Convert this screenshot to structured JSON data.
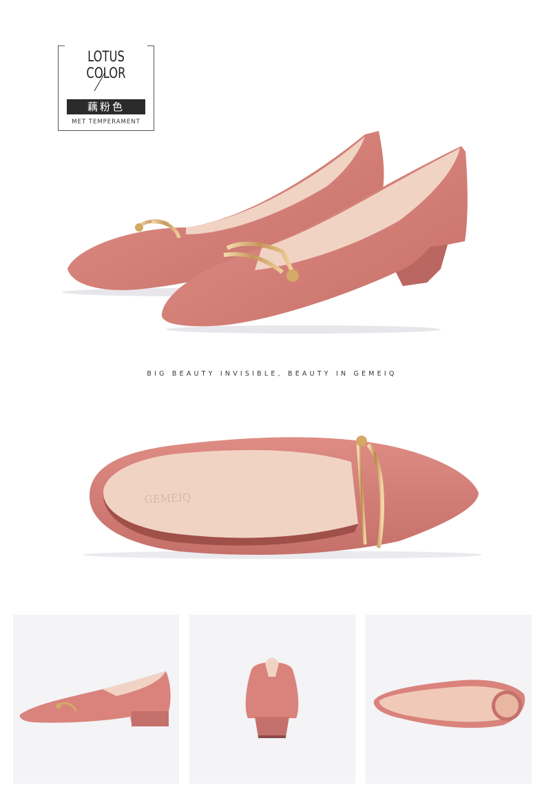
{
  "label": {
    "title_en": "LOTUS COLOR",
    "title_cn": "藕粉色",
    "subtitle": "MET TEMPERAMENT"
  },
  "tagline": "BIG BEAUTY INVISIBLE, BEAUTY IN GEMEIQ",
  "insole_brand": "GEMEIQ",
  "colors": {
    "suede": "#d9837c",
    "suede_dark": "#b96760",
    "lining": "#f1d3c4",
    "gold": "#d9b27a",
    "thumb_bg": "#f4f3f6"
  },
  "images": [
    {
      "name": "pair-side-view"
    },
    {
      "name": "top-view"
    },
    {
      "name": "thumb-side-view"
    },
    {
      "name": "thumb-back-view"
    },
    {
      "name": "thumb-sole-view"
    }
  ]
}
